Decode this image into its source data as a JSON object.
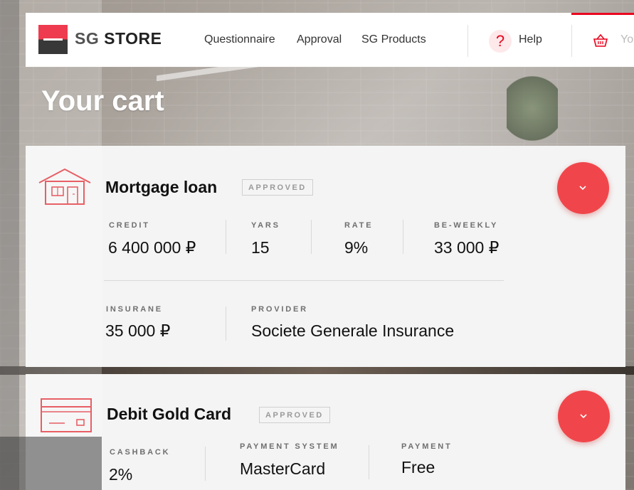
{
  "header": {
    "logo_text": "SG STORE",
    "nav": [
      "Questionnaire",
      "Approval",
      "SG Products"
    ],
    "help_label": "Help",
    "basket_label": "Yo"
  },
  "page": {
    "title": "Your cart"
  },
  "cards": [
    {
      "icon": "house-icon",
      "title": "Mortgage loan",
      "badge": "APPROVED",
      "fields": {
        "credit_label": "CREDIT",
        "credit_value": "6 400 000 ₽",
        "years_label": "YARS",
        "years_value": "15",
        "rate_label": "RATE",
        "rate_value": "9%",
        "biweekly_label": "BE-WEEKLY",
        "biweekly_value": "33 000 ₽",
        "insurance_label": "INSURANE",
        "insurance_value": "35 000 ₽",
        "provider_label": "PROVIDER",
        "provider_value": "Societe Generale Insurance"
      }
    },
    {
      "icon": "credit-card-icon",
      "title": "Debit Gold Card",
      "badge": "APPROVED",
      "fields": {
        "cashback_label": "CASHBACK",
        "cashback_value": "2%",
        "system_label": "PAYMENT SYSTEM",
        "system_value": "MasterCard",
        "payment_label": "PAYMENT",
        "payment_value": "Free"
      }
    }
  ],
  "colors": {
    "accent": "#e9041e",
    "button": "#f0464b",
    "card_bg": "#f4f4f4"
  }
}
